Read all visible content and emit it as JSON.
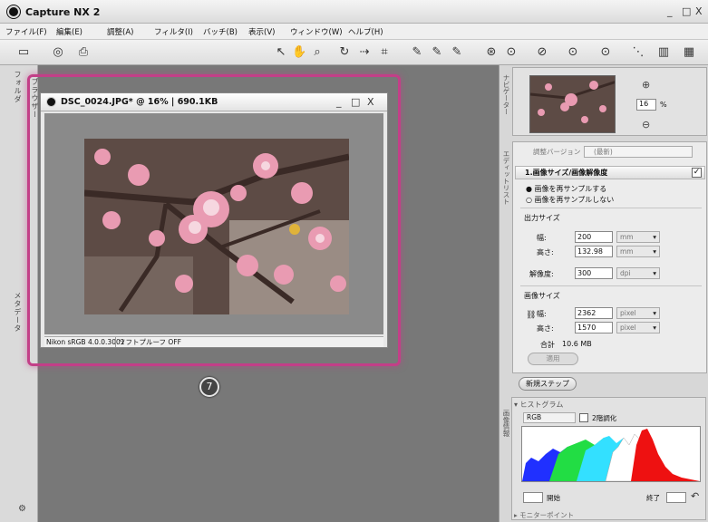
{
  "app": {
    "title": "Capture NX 2"
  },
  "window_controls": {
    "minimize": "_",
    "maximize": "□",
    "close": "X"
  },
  "menu": [
    "ファイル(F)",
    "編集(E)",
    "調整(A)",
    "フィルタ(I)",
    "バッチ(B)",
    "表示(V)",
    "ウィンドウ(W)",
    "ヘルプ(H)"
  ],
  "toolbar": {
    "icons": [
      "browser-toggle-icon",
      "inspect-icon",
      "print-icon",
      "arrow-select-icon",
      "hand-icon",
      "zoom-icon",
      "rotate-icon",
      "straighten-icon",
      "crop-icon",
      "black-point-icon",
      "neutral-point-icon",
      "white-point-icon",
      "red-eye-icon",
      "auto-retouch-icon",
      "selection-brush-icon",
      "color-control-point-icon",
      "lasso-icon",
      "gradient-icon",
      "fill-icon"
    ]
  },
  "left_dock": {
    "tab_folders": "フォルダ",
    "tab_browser": "ブラウザー",
    "tab_metadata": "メタデータ"
  },
  "document": {
    "title": "DSC_0024.JPG* @ 16% | 690.1KB",
    "status_profile": "Nikon sRGB 4.0.0.3001",
    "status_softproof": "ソフトプルーフ OFF"
  },
  "callout": {
    "number": "7"
  },
  "navigator": {
    "tab_label": "ナビゲーター",
    "zoom_value": "16",
    "zoom_unit": "%"
  },
  "edit_list": {
    "tab_label": "エディットリスト",
    "version_label": "調整バージョン",
    "version_value": "(最新)",
    "section_title": "1.画像サイズ/画像解像度",
    "resample_on": "画像を再サンプルする",
    "resample_off": "画像を再サンプルしない",
    "output_size_label": "出力サイズ",
    "width_label": "幅:",
    "width_value": "200",
    "width_unit": "mm",
    "height_label": "高さ:",
    "height_value": "132.98",
    "height_unit": "mm",
    "resolution_label": "解像度:",
    "resolution_value": "300",
    "resolution_unit": "dpi",
    "image_size_label": "画像サイズ",
    "px_width_label": "幅:",
    "px_width_value": "2362",
    "px_width_unit": "pixel",
    "px_height_label": "高さ:",
    "px_height_value": "1570",
    "px_height_unit": "pixel",
    "total_label": "合計",
    "total_value": "10.6 MB",
    "apply_label": "適用"
  },
  "new_step": {
    "label": "新規ステップ"
  },
  "histogram": {
    "header": "ヒストグラム",
    "channel": "RGB",
    "two_point_label": "2階調化",
    "start_label": "開始",
    "end_label": "終了",
    "monitor_label": "モニターポイント",
    "side_label": "画像情報"
  }
}
